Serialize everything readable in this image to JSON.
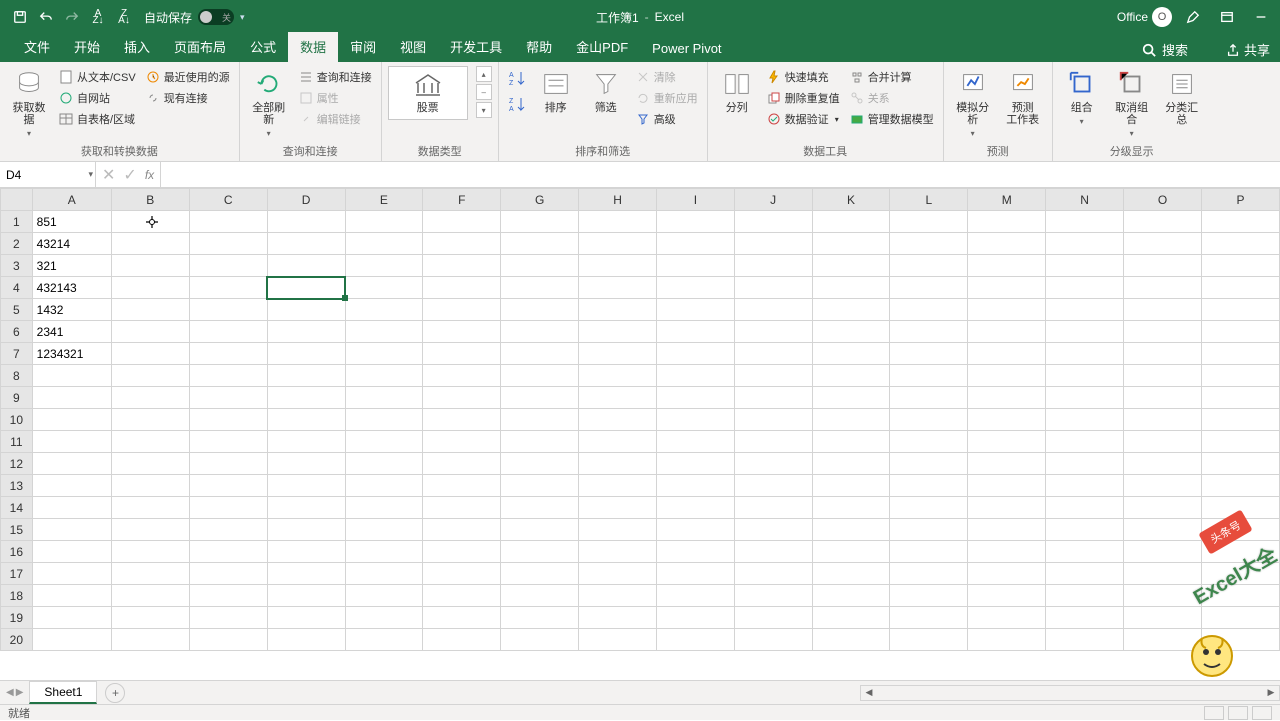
{
  "titlebar": {
    "autosave_label": "自动保存",
    "autosave_state": "关",
    "workbook": "工作簿1",
    "dash": "-",
    "app": "Excel",
    "office_label": "Office",
    "office_badge": "O"
  },
  "tabs": {
    "file": "文件",
    "home": "开始",
    "insert": "插入",
    "layout": "页面布局",
    "formulas": "公式",
    "data": "数据",
    "review": "审阅",
    "view": "视图",
    "dev": "开发工具",
    "help": "帮助",
    "pdf": "金山PDF",
    "pivot": "Power Pivot",
    "search_placeholder": "搜索",
    "share": "共享"
  },
  "ribbon": {
    "get_data": {
      "big": "获取数\n据",
      "from_csv": "从文本/CSV",
      "from_web": "自网站",
      "from_table": "自表格/区域",
      "recent": "最近使用的源",
      "existing": "现有连接",
      "group_label": "获取和转换数据"
    },
    "queries": {
      "refresh": "全部刷新",
      "queries_conn": "查询和连接",
      "properties": "属性",
      "edit_links": "编辑链接",
      "group_label": "查询和连接"
    },
    "datatypes": {
      "stocks": "股票",
      "group_label": "数据类型"
    },
    "sort_filter": {
      "sort": "排序",
      "filter": "筛选",
      "clear": "清除",
      "reapply": "重新应用",
      "advanced": "高级",
      "group_label": "排序和筛选"
    },
    "text_to_col": {
      "big": "分列",
      "flash": "快速填充",
      "remove_dup": "删除重复值",
      "validation": "数据验证",
      "consolidate": "合并计算",
      "relations": "关系",
      "manage_model": "管理数据模型",
      "group_label": "数据工具"
    },
    "forecast": {
      "whatif": "模拟分析",
      "forecast_sheet": "预测\n工作表",
      "group_label": "预测"
    },
    "outline": {
      "group": "组合",
      "ungroup": "取消组合",
      "subtotal": "分类汇总",
      "group_label": "分级显示"
    }
  },
  "formula_bar": {
    "name": "D4",
    "cancel": "✕",
    "enter": "✓",
    "fx": "fx"
  },
  "columns": [
    "A",
    "B",
    "C",
    "D",
    "E",
    "F",
    "G",
    "H",
    "I",
    "J",
    "K",
    "L",
    "M",
    "N",
    "O",
    "P"
  ],
  "rows": [
    "1",
    "2",
    "3",
    "4",
    "5",
    "6",
    "7",
    "8",
    "9",
    "10",
    "11",
    "12",
    "13",
    "14",
    "15",
    "16",
    "17",
    "18",
    "19",
    "20"
  ],
  "cells": {
    "A1": "851",
    "A2": "43214",
    "A3": "321",
    "A4": "432143",
    "A5": "1432",
    "A6": "2341",
    "A7": "1234321"
  },
  "selected": "D4",
  "sheet": {
    "name": "Sheet1",
    "add": "+",
    "nav_prev": "◀",
    "nav_next": "▶"
  },
  "status": {
    "ready": "就绪"
  },
  "watermark": {
    "text": "Excel大全",
    "badge": "头条号"
  }
}
